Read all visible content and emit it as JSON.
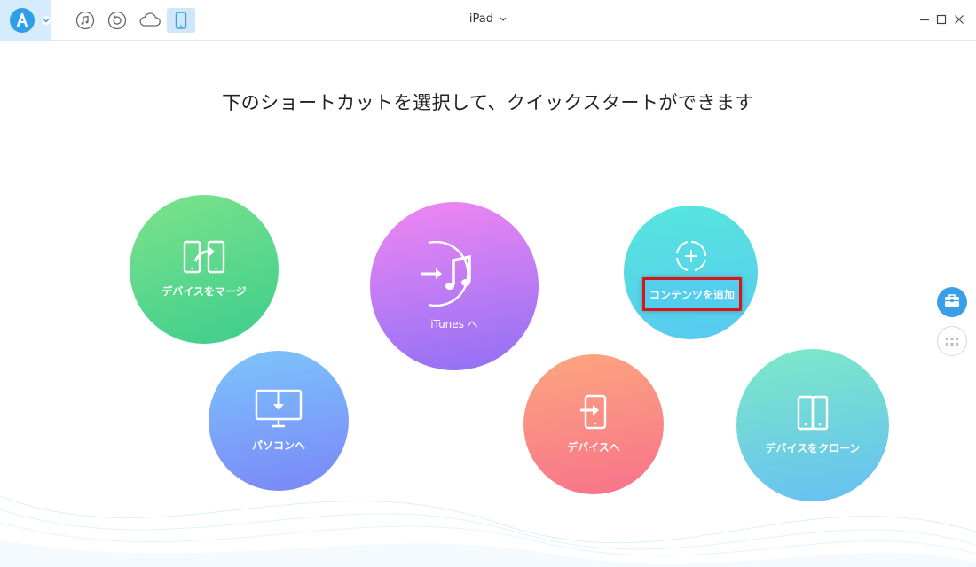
{
  "header": {
    "device_title": "iPad"
  },
  "toolbar": {
    "icons": [
      "music-icon",
      "restore-icon",
      "cloud-icon",
      "phone-icon"
    ]
  },
  "main": {
    "headline": "下のショートカットを選択して、クイックスタートができます",
    "shortcuts": {
      "merge": "デバイスをマージ",
      "itunes": "iTunes へ",
      "add_content": "コンテンツを追加",
      "to_pc": "パソコンへ",
      "to_device": "デバイスへ",
      "clone": "デバイスをクローン"
    }
  },
  "colors": {
    "accent": "#2e9ee8",
    "highlight_border": "#d9141a"
  }
}
